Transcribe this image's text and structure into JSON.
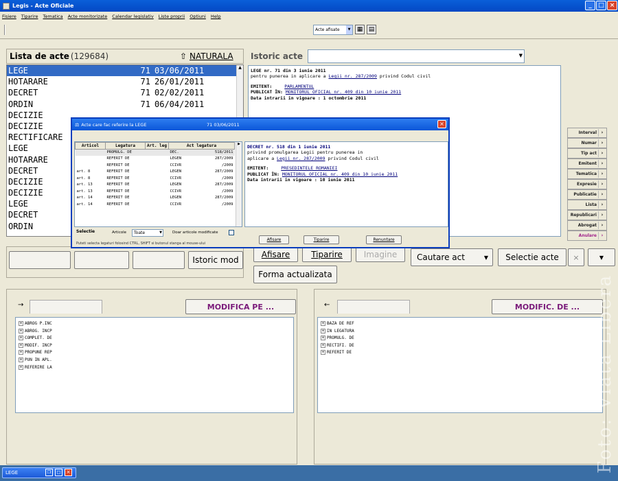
{
  "window": {
    "title": "Legis - Acte Oficiale"
  },
  "menu": [
    "Fisiere",
    "Tiparire",
    "Tematica",
    "Acte monitorizate",
    "Calendar legislativ",
    "Liste proprii",
    "Optiuni",
    "Help"
  ],
  "toolbar": {
    "combo_value": "Acte afisate"
  },
  "list": {
    "title": "Lista de acte",
    "count": "(129684)",
    "sort_label": "NATURALA",
    "rows": [
      {
        "type": "LEGE",
        "num": "71",
        "date": "03/06/2011"
      },
      {
        "type": "HOTARARE",
        "num": "71",
        "date": "26/01/2011"
      },
      {
        "type": "DECRET",
        "num": "71",
        "date": "02/02/2011"
      },
      {
        "type": "ORDIN",
        "num": "71",
        "date": "06/04/2011"
      },
      {
        "type": "DECIZIE",
        "num": "",
        "date": ""
      },
      {
        "type": "DECIZIE",
        "num": "",
        "date": ""
      },
      {
        "type": "RECTIFICARE",
        "num": "",
        "date": ""
      },
      {
        "type": "LEGE",
        "num": "",
        "date": ""
      },
      {
        "type": "HOTARARE",
        "num": "",
        "date": ""
      },
      {
        "type": "DECRET",
        "num": "",
        "date": ""
      },
      {
        "type": "DECIZIE",
        "num": "",
        "date": ""
      },
      {
        "type": "DECIZIE",
        "num": "",
        "date": ""
      },
      {
        "type": "LEGE",
        "num": "",
        "date": ""
      },
      {
        "type": "DECRET",
        "num": "",
        "date": ""
      },
      {
        "type": "ORDIN",
        "num": "",
        "date": ""
      }
    ],
    "bottom_button": "Istoric mod"
  },
  "istoric": {
    "label": "Istoric acte"
  },
  "detail": {
    "line1": "LEGE nr. 71 din 3 iunie 2011",
    "line2a": "pentru punerea in aplicare a ",
    "line2_link": "Legii nr. 287/2009",
    "line2b": " privind Codul civil",
    "emitent_label": "EMITENT:",
    "emitent": "PARLAMENTUL",
    "publicat_label": "PUBLICAT ÎN:",
    "publicat": "MONITORUL OFICIAL nr. 409 din 10 iunie 2011",
    "vigoare": "Data intrarii in vigoare : 1 octombrie 2011"
  },
  "nav_buttons": [
    "Interval",
    "Numar",
    "Tip act",
    "Emitent",
    "Tematica",
    "Expresie",
    "Publicatie",
    "Lista",
    "Republicari",
    "Abrogat",
    "Anulare"
  ],
  "action_buttons": {
    "afisare": "Afisare",
    "tiparire": "Tiparire",
    "imagine": "Imagine",
    "forma": "Forma actualizata",
    "cautare": "Cautare act",
    "selectie": "Selectie acte"
  },
  "left_bottom": {
    "header": "MODIFICA PE ...",
    "items": [
      "ABROG P.INC",
      "ABROG. INCP",
      "COMPLET. DE",
      "MODIF. INCP",
      "PROPUNE REP",
      "PUN IN APL.",
      "REFERIRE LA"
    ]
  },
  "right_bottom": {
    "header": "MODIFIC. DE ...",
    "items": [
      "BAZA DE REF",
      "IN LEGATURA",
      "PROMULG. DE",
      "RECTIFI. DE",
      "REFERIT DE"
    ]
  },
  "dialog": {
    "title": "Acte  care fac referire la LEGE",
    "title_ref": "71 03/06/2011",
    "columns": [
      "Articol",
      "Legatura",
      "Art. leg",
      "Act legatura"
    ],
    "rows": [
      {
        "art": "",
        "leg": "PROMULG. DE",
        "al": "",
        "act": "DEC.",
        "ref": "518/2011"
      },
      {
        "art": "",
        "leg": "REFERIT DE",
        "al": "",
        "act": "LEGEN",
        "ref": "287/2009"
      },
      {
        "art": "",
        "leg": "REFERIT DE",
        "al": "",
        "act": "CCIVR",
        "ref": "/2009"
      },
      {
        "art": "art.  8",
        "leg": "REFERIT DE",
        "al": "",
        "act": "LEGEN",
        "ref": "287/2009"
      },
      {
        "art": "art.  8",
        "leg": "REFERIT DE",
        "al": "",
        "act": "CCIVR",
        "ref": "/2009"
      },
      {
        "art": "art. 13",
        "leg": "REFERIT DE",
        "al": "",
        "act": "LEGEN",
        "ref": "287/2009"
      },
      {
        "art": "art. 13",
        "leg": "REFERIT DE",
        "al": "",
        "act": "CCIVR",
        "ref": "/2009"
      },
      {
        "art": "art. 14",
        "leg": "REFERIT DE",
        "al": "",
        "act": "LEGEN",
        "ref": "287/2009"
      },
      {
        "art": "art. 14",
        "leg": "REFERIT DE",
        "al": "",
        "act": "CCIVR",
        "ref": "/2009"
      }
    ],
    "selectie_label": "Selectie",
    "articole_label": "Articole",
    "articole_value": "Toate",
    "doar_label": "Doar articole modificate",
    "hint": "Puteti selecta legaturi folosind CTRL, SHIFT si butonul stanga al mouse-ului",
    "detail": {
      "line1": "DECRET nr. 518 din 1 iunie 2011",
      "line2": "privind promulgarea Legii pentru punerea in",
      "line3a": "aplicare a ",
      "line3_link": "Legii nr. 287/2009",
      "line3b": " privind Codul civil",
      "emitent_label": "EMITENT:",
      "emitent": "PRESEDINTELE ROMANIEI",
      "publicat_label": "PUBLICAT ÎN:",
      "publicat": "MONITORUL OFICIAL nr. 409 din 10 iunie 2011",
      "vigoare": "Data intrarii in vigoare : 10 iunie 2011"
    },
    "btn_afisare": "Afisare",
    "btn_tiparire": "Tiparire",
    "btn_renuntare": "Renuntare"
  },
  "taskbar": {
    "item": "LEGE"
  },
  "watermark": "Foto: Viata Libera"
}
